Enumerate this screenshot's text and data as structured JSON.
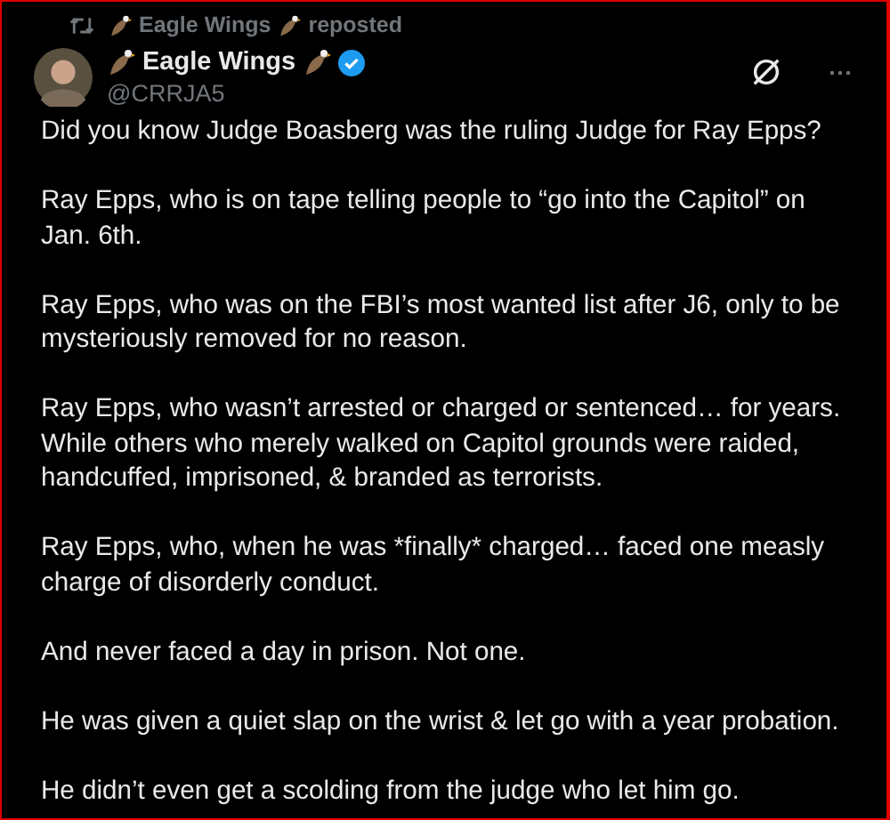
{
  "repost": {
    "name": "Eagle Wings",
    "label": "reposted"
  },
  "author": {
    "name": "Eagle Wings",
    "verified": true,
    "handle": "@CRRJA5"
  },
  "paragraphs": [
    "Did you know Judge Boasberg was the ruling Judge for Ray Epps?",
    "Ray Epps, who is on tape telling people to “go into the Capitol” on Jan. 6th.",
    "Ray Epps, who was on the FBI’s most wanted list after J6, only to be mysteriously removed for no reason.",
    "Ray Epps, who wasn’t arrested or charged or sentenced… for years. While others who merely walked on Capitol grounds were raided, handcuffed, imprisoned, & branded as terrorists.",
    "Ray Epps, who, when he was *finally* charged… faced one measly charge of disorderly conduct.",
    "And never faced a day in prison. Not one.",
    "He was given a quiet slap on the wrist & let go with a year probation.",
    "He didn’t even get a scolding from the judge who let him go."
  ]
}
